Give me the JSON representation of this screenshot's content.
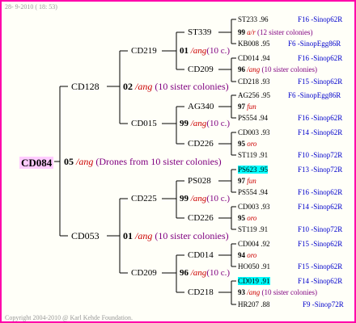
{
  "header_date": "28- 9-2010 ( 18: 53)",
  "footer": "Copyright 2004-2010 @ Karl Kehde Foundation.",
  "root": {
    "id": "CD084",
    "num": "05",
    "mark": "/ang",
    "note": "(Drones from 10 sister colonies)"
  },
  "l1": [
    {
      "id": "CD128",
      "num": "02",
      "mark": "/ang",
      "note": "(10 sister colonies)"
    },
    {
      "id": "CD053",
      "num": "01",
      "mark": "/ang",
      "note": "(10 sister colonies)"
    }
  ],
  "l2": [
    {
      "id": "CD219",
      "num": "01",
      "mark": "/ang",
      "note": "(10 c.)"
    },
    {
      "id": "CD015",
      "num": "99",
      "mark": "/ang",
      "note": "(10 c.)"
    },
    {
      "id": "CD225",
      "num": "99",
      "mark": "/ang",
      "note": "(10 c.)"
    },
    {
      "id": "CD209",
      "num": "96",
      "mark": "/ang",
      "note": "(10 c.)"
    }
  ],
  "l3": [
    {
      "id": "ST339",
      "num": "99",
      "mark": "a/r",
      "note": "(12 sister colonies)"
    },
    {
      "id": "CD209",
      "num": "96",
      "mark": "/ang",
      "note": "(10 sister colonies)"
    },
    {
      "id": "AG340",
      "num": "97",
      "mark": "fun",
      "note": ""
    },
    {
      "id": "CD226",
      "num": "95",
      "mark": "oro",
      "note": ""
    },
    {
      "id": "PS028",
      "num": "97",
      "mark": "fun",
      "note": ""
    },
    {
      "id": "CD226",
      "num": "95",
      "mark": "oro",
      "note": ""
    },
    {
      "id": "CD014",
      "num": "94",
      "mark": "oro",
      "note": ""
    },
    {
      "id": "CD218",
      "num": "93",
      "mark": "/ang",
      "note": "(10 sister colonies)"
    }
  ],
  "l4": [
    {
      "id": "ST233",
      "val": ".96",
      "loc": "F16 -Sinop62R"
    },
    {
      "id": "KB008",
      "val": ".95",
      "loc": "F6 -SinopEgg86R"
    },
    {
      "id": "CD014",
      "val": ".94",
      "loc": "F16 -Sinop62R"
    },
    {
      "id": "CD218",
      "val": ".93",
      "loc": "F15 -Sinop62R"
    },
    {
      "id": "AG256",
      "val": ".95",
      "loc": "F6 -SinopEgg86R"
    },
    {
      "id": "PS554",
      "val": ".94",
      "loc": "F16 -Sinop62R"
    },
    {
      "id": "CD003",
      "val": ".93",
      "loc": "F14 -Sinop62R"
    },
    {
      "id": "ST119",
      "val": ".91",
      "loc": "F10 -Sinop72R"
    },
    {
      "id": "PS623",
      "val": ".95",
      "loc": "F13 -Sinop72R"
    },
    {
      "id": "PS554",
      "val": ".94",
      "loc": "F16 -Sinop62R"
    },
    {
      "id": "CD003",
      "val": ".93",
      "loc": "F14 -Sinop62R"
    },
    {
      "id": "ST119",
      "val": ".91",
      "loc": "F10 -Sinop72R"
    },
    {
      "id": "CD004",
      "val": ".92",
      "loc": "F15 -Sinop62R"
    },
    {
      "id": "HO050",
      "val": ".91",
      "loc": "F15 -Sinop62R"
    },
    {
      "id": "CD019",
      "val": ".91",
      "loc": "F14 -Sinop62R"
    },
    {
      "id": "HR207",
      "val": ".88",
      "loc": "F9 -Sinop72R"
    }
  ]
}
